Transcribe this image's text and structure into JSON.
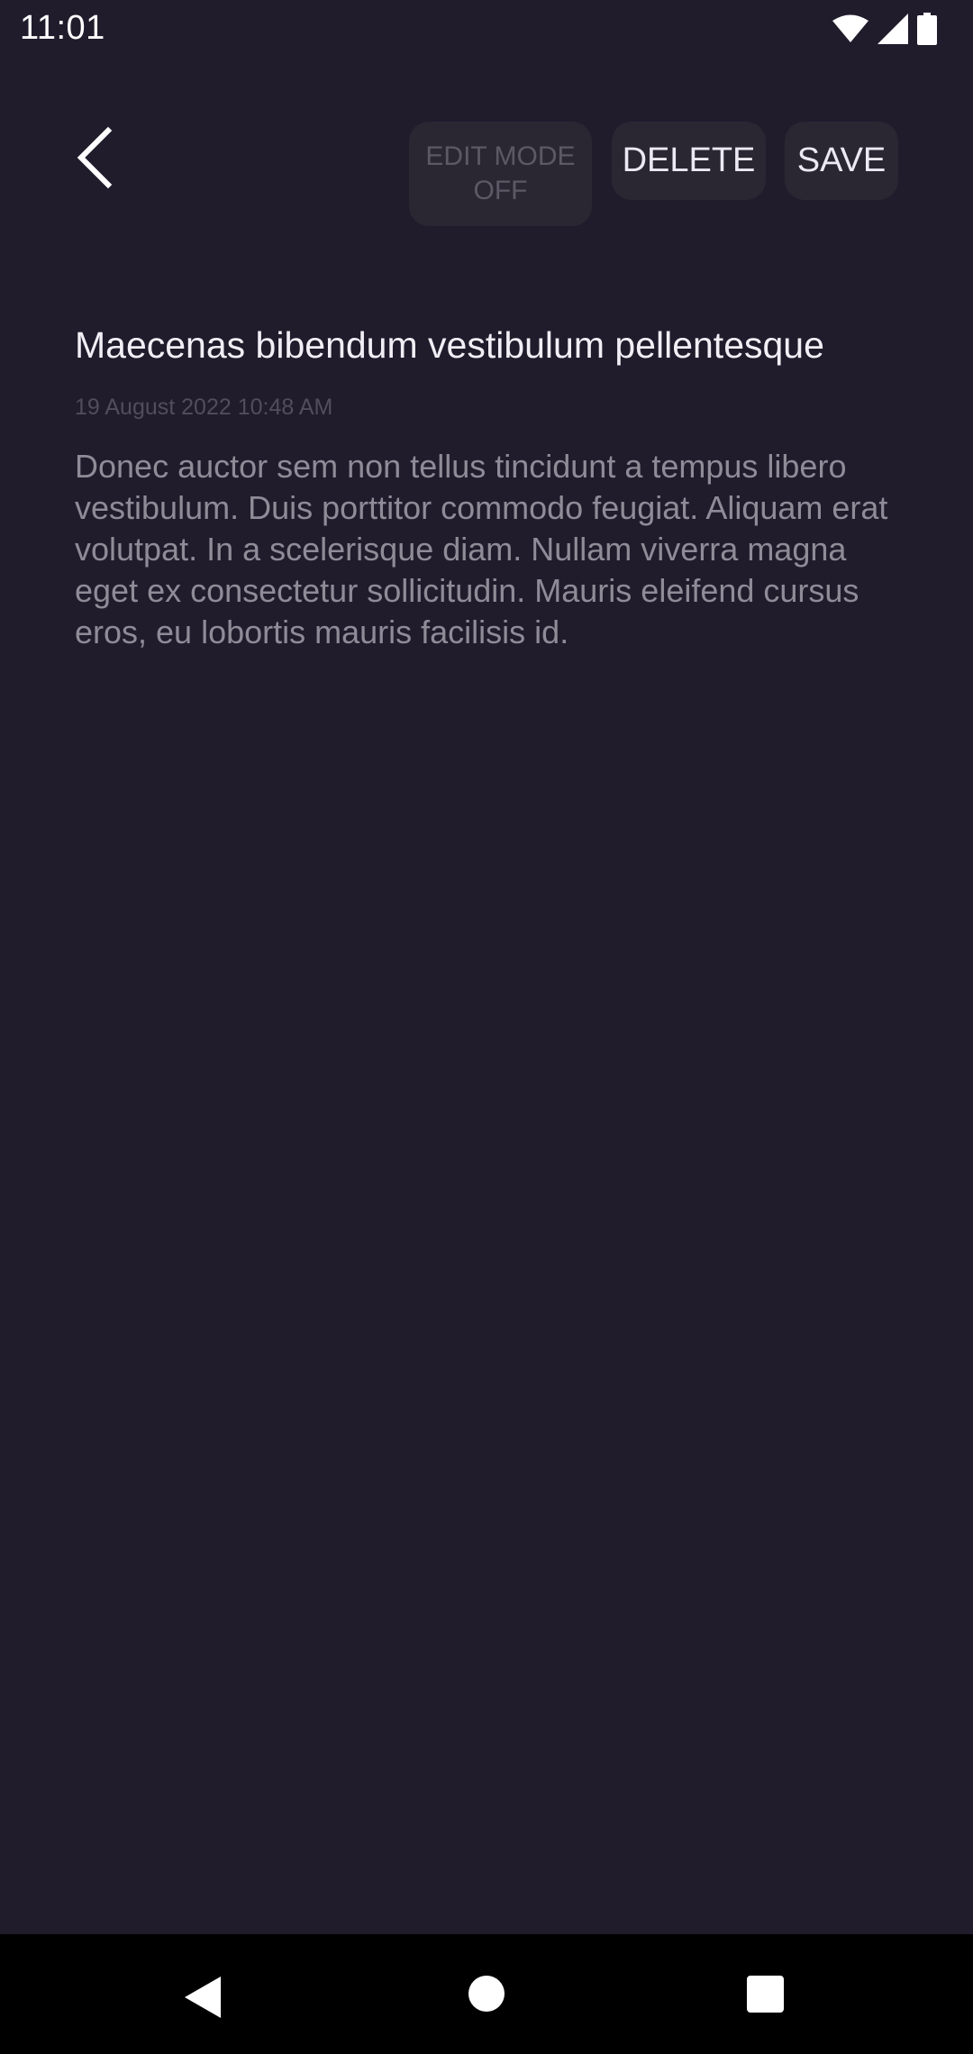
{
  "status_bar": {
    "time": "11:01",
    "icons": [
      "wifi-icon",
      "cellular-signal-icon",
      "battery-icon"
    ]
  },
  "toolbar": {
    "back_icon": "chevron-left-icon",
    "edit_mode_label": "EDIT MODE OFF",
    "delete_label": "DELETE",
    "save_label": "SAVE"
  },
  "note": {
    "title": "Maecenas bibendum vestibulum pellentesque",
    "date": "19 August 2022 10:48 AM",
    "body": "Donec auctor sem non tellus tincidunt a tempus libero vestibulum. Duis porttitor commodo feugiat. Aliquam erat volutpat. In a scelerisque diam. Nullam viverra magna eget ex consectetur sollicitudin. Mauris eleifend cursus eros, eu lobortis mauris facilisis id."
  },
  "nav_bar": {
    "icons": [
      "back-triangle-icon",
      "home-circle-icon",
      "recents-square-icon"
    ]
  },
  "colors": {
    "background": "#201c2c",
    "button_bg": "#2a2733",
    "title_text": "#f1eff5",
    "body_text": "#8f8c98",
    "date_text": "#514e5b",
    "disabled_text": "#5c5966"
  }
}
